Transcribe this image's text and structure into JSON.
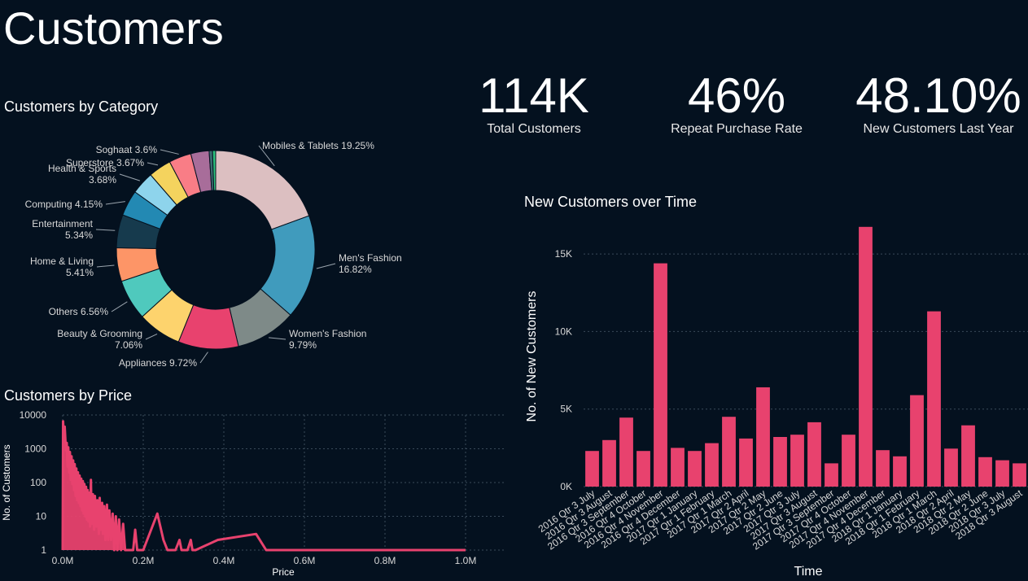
{
  "page": {
    "title": "Customers"
  },
  "kpis": [
    {
      "value": "114K",
      "label": "Total Customers"
    },
    {
      "value": "46%",
      "label": "Repeat Purchase Rate"
    },
    {
      "value": "48.10%",
      "label": "New Customers Last Year"
    }
  ],
  "sections": {
    "category": "Customers by Category",
    "price": "Customers by Price",
    "time": "New Customers over Time"
  },
  "colors": {
    "background": "#04111f",
    "bar": "#e8426e",
    "gridline": "#3a4a5a",
    "axis_text": "#d8d8d8"
  },
  "chart_data": [
    {
      "id": "category",
      "type": "pie",
      "title": "Customers by Category",
      "donut": true,
      "slices": [
        {
          "label": "Mobiles & Tablets",
          "pct_label": "19.25%",
          "value": 19.25,
          "color": "#dcbfc1"
        },
        {
          "label": "Men's Fashion",
          "pct_label": "16.82%",
          "value": 16.82,
          "color": "#409bbd"
        },
        {
          "label": "Women's Fashion",
          "pct_label": "9.79%",
          "value": 9.79,
          "color": "#7e8a88"
        },
        {
          "label": "Appliances",
          "pct_label": "9.72%",
          "value": 9.72,
          "color": "#e8426e"
        },
        {
          "label": "Beauty & Grooming",
          "pct_label": "7.06%",
          "value": 7.06,
          "color": "#fdd36d"
        },
        {
          "label": "Others",
          "pct_label": "6.56%",
          "value": 6.56,
          "color": "#4fc9bd"
        },
        {
          "label": "Home & Living",
          "pct_label": "5.41%",
          "value": 5.41,
          "color": "#fd9567"
        },
        {
          "label": "Entertainment",
          "pct_label": "5.34%",
          "value": 5.34,
          "color": "#163a4d"
        },
        {
          "label": "Computing",
          "pct_label": "4.15%",
          "value": 4.15,
          "color": "#2389b3"
        },
        {
          "label": "Health & Sports",
          "pct_label": "3.68%",
          "value": 3.68,
          "color": "#8ed4ec"
        },
        {
          "label": "Superstore",
          "pct_label": "3.67%",
          "value": 3.67,
          "color": "#f4d35e"
        },
        {
          "label": "Soghaat",
          "pct_label": "3.6%",
          "value": 3.6,
          "color": "#f97d86"
        },
        {
          "label": "",
          "pct_label": "",
          "value": 2.95,
          "color": "#a86d9a"
        },
        {
          "label": "",
          "pct_label": "",
          "value": 0.55,
          "color": "#3a6b70"
        },
        {
          "label": "",
          "pct_label": "",
          "value": 0.5,
          "color": "#2ec27e"
        }
      ]
    },
    {
      "id": "price",
      "type": "line",
      "title": "Customers by Price",
      "xlabel": "Price",
      "ylabel": "No. of Customers",
      "yscale": "log",
      "ylim": [
        1,
        10000
      ],
      "xlim": [
        0,
        1000000
      ],
      "x_ticks": [
        0,
        200000,
        400000,
        600000,
        800000,
        1000000
      ],
      "x_tick_labels": [
        "0.0M",
        "0.2M",
        "0.4M",
        "0.6M",
        "0.8M",
        "1.0M"
      ],
      "y_ticks": [
        1,
        10,
        100,
        1000,
        10000
      ],
      "y_tick_labels": [
        "1",
        "10",
        "100",
        "1000",
        "10000"
      ],
      "grid": true,
      "points": [
        [
          0,
          1
        ],
        [
          1000,
          6500
        ],
        [
          3000,
          2000
        ],
        [
          5000,
          4500
        ],
        [
          8000,
          900
        ],
        [
          10000,
          1500
        ],
        [
          12000,
          300
        ],
        [
          14000,
          1100
        ],
        [
          16000,
          200
        ],
        [
          18000,
          800
        ],
        [
          20000,
          120
        ],
        [
          22000,
          600
        ],
        [
          24000,
          90
        ],
        [
          26000,
          450
        ],
        [
          28000,
          60
        ],
        [
          30000,
          350
        ],
        [
          32000,
          40
        ],
        [
          34000,
          260
        ],
        [
          36000,
          30
        ],
        [
          38000,
          200
        ],
        [
          40000,
          25
        ],
        [
          42000,
          160
        ],
        [
          44000,
          20
        ],
        [
          46000,
          130
        ],
        [
          48000,
          15
        ],
        [
          50000,
          110
        ],
        [
          52000,
          12
        ],
        [
          54000,
          90
        ],
        [
          56000,
          10
        ],
        [
          58000,
          75
        ],
        [
          60000,
          8
        ],
        [
          62000,
          60
        ],
        [
          64000,
          7
        ],
        [
          66000,
          50
        ],
        [
          68000,
          5
        ],
        [
          70000,
          120
        ],
        [
          72000,
          6
        ],
        [
          75000,
          45
        ],
        [
          78000,
          4
        ],
        [
          80000,
          40
        ],
        [
          83000,
          5
        ],
        [
          86000,
          30
        ],
        [
          90000,
          3
        ],
        [
          92000,
          35
        ],
        [
          95000,
          4
        ],
        [
          98000,
          25
        ],
        [
          100000,
          3
        ],
        [
          103000,
          20
        ],
        [
          106000,
          2
        ],
        [
          110000,
          22
        ],
        [
          113000,
          2
        ],
        [
          116000,
          15
        ],
        [
          120000,
          2
        ],
        [
          124000,
          12
        ],
        [
          128000,
          1
        ],
        [
          132000,
          10
        ],
        [
          136000,
          1
        ],
        [
          140000,
          8
        ],
        [
          145000,
          1
        ],
        [
          150000,
          6
        ],
        [
          155000,
          1
        ],
        [
          160000,
          1
        ],
        [
          175000,
          1
        ],
        [
          180000,
          4
        ],
        [
          185000,
          1
        ],
        [
          200000,
          1
        ],
        [
          235000,
          12
        ],
        [
          250000,
          2
        ],
        [
          260000,
          1
        ],
        [
          280000,
          1
        ],
        [
          290000,
          2
        ],
        [
          295000,
          1
        ],
        [
          300000,
          1
        ],
        [
          310000,
          1
        ],
        [
          318000,
          2
        ],
        [
          322000,
          1
        ],
        [
          330000,
          1
        ],
        [
          385000,
          2
        ],
        [
          480000,
          3
        ],
        [
          505000,
          1
        ],
        [
          600000,
          1
        ],
        [
          800000,
          1
        ],
        [
          1000000,
          1
        ]
      ]
    },
    {
      "id": "time",
      "type": "bar",
      "title": "New Customers over Time",
      "xlabel": "Time",
      "ylabel": "No. of New Customers",
      "ylim": [
        0,
        17000
      ],
      "y_ticks": [
        0,
        5000,
        10000,
        15000
      ],
      "y_tick_labels": [
        "0K",
        "5K",
        "10K",
        "15K"
      ],
      "grid": true,
      "categories": [
        "2016 Qtr 3 July",
        "2016 Qtr 3 August",
        "2016 Qtr 3 September",
        "2016 Qtr 4 October",
        "2016 Qtr 4 November",
        "2016 Qtr 4 December",
        "2017 Qtr 1 January",
        "2017 Qtr 1 February",
        "2017 Qtr 1 March",
        "2017 Qtr 2 April",
        "2017 Qtr 2 May",
        "2017 Qtr 2 June",
        "2017 Qtr 3 July",
        "2017 Qtr 3 August",
        "2017 Qtr 3 September",
        "2017 Qtr 4 October",
        "2017 Qtr 4 November",
        "2017 Qtr 4 December",
        "2018 Qtr 1 January",
        "2018 Qtr 1 February",
        "2018 Qtr 1 March",
        "2018 Qtr 2 April",
        "2018 Qtr 2 May",
        "2018 Qtr 2 June",
        "2018 Qtr 3 July",
        "2018 Qtr 3 August"
      ],
      "values": [
        2300,
        3000,
        4450,
        2300,
        14400,
        2500,
        2300,
        2800,
        4500,
        3100,
        6400,
        3200,
        3350,
        4150,
        1500,
        3350,
        16750,
        2350,
        1950,
        5900,
        11300,
        2450,
        3950,
        1900,
        1700,
        1500
      ]
    }
  ]
}
